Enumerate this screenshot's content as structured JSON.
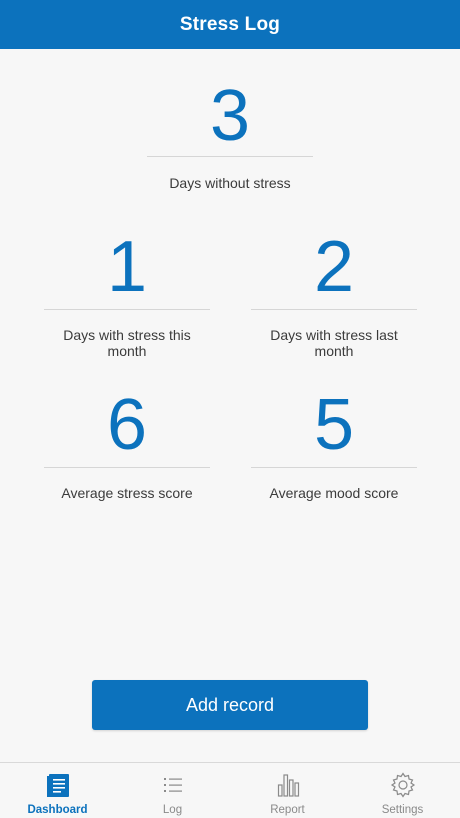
{
  "app_bar": {
    "title": "Stress Log"
  },
  "stats": {
    "days_without_stress": {
      "value": "3",
      "label": "Days without stress"
    },
    "this_month": {
      "value": "1",
      "label": "Days with stress this month"
    },
    "last_month": {
      "value": "2",
      "label": "Days with stress last month"
    },
    "avg_stress": {
      "value": "6",
      "label": "Average stress score"
    },
    "avg_mood": {
      "value": "5",
      "label": "Average mood score"
    }
  },
  "actions": {
    "add_record": "Add record"
  },
  "nav": {
    "items": [
      {
        "label": "Dashboard",
        "icon": "dashboard-icon",
        "active": true
      },
      {
        "label": "Log",
        "icon": "list-icon",
        "active": false
      },
      {
        "label": "Report",
        "icon": "bar-chart-icon",
        "active": false
      },
      {
        "label": "Settings",
        "icon": "gear-icon",
        "active": false
      }
    ]
  },
  "colors": {
    "primary": "#0c72bd",
    "background": "#f7f7f7",
    "inactive": "#8a8a8a"
  }
}
